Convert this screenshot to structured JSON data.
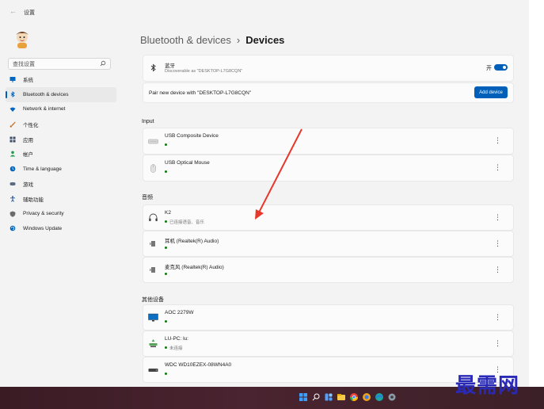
{
  "window": {
    "title": "设置"
  },
  "search": {
    "placeholder": "查找设置"
  },
  "sidebar": {
    "items": [
      {
        "label": "系统",
        "icon": "monitor-icon",
        "color": "#0067c0",
        "active": false
      },
      {
        "label": "Bluetooth & devices",
        "icon": "bluetooth-icon",
        "color": "#0067c0",
        "active": true
      },
      {
        "label": "Network & internet",
        "icon": "wifi-icon",
        "color": "#0067c0",
        "active": false
      },
      {
        "label": "个性化",
        "icon": "brush-icon",
        "color": "#c26b1b",
        "active": false
      },
      {
        "label": "应用",
        "icon": "apps-icon",
        "color": "#3c4b66",
        "active": false
      },
      {
        "label": "帐户",
        "icon": "person-icon",
        "color": "#1d9a4b",
        "active": false
      },
      {
        "label": "Time & language",
        "icon": "globe-clock-icon",
        "color": "#0067c0",
        "active": false
      },
      {
        "label": "游戏",
        "icon": "gamepad-icon",
        "color": "#5d6b82",
        "active": false
      },
      {
        "label": "辅助功能",
        "icon": "accessibility-icon",
        "color": "#1b4f9c",
        "active": false
      },
      {
        "label": "Privacy & security",
        "icon": "shield-icon",
        "color": "#6b6b6b",
        "active": false
      },
      {
        "label": "Windows Update",
        "icon": "update-icon",
        "color": "#0067c0",
        "active": false
      }
    ]
  },
  "breadcrumb": {
    "parent": "Bluetooth & devices",
    "separator": "›",
    "current": "Devices"
  },
  "bluetooth": {
    "title": "蓝牙",
    "subtitle": "Discoverable as \"DESKTOP-L7G8CQN\"",
    "toggle_label": "开",
    "toggle_on": true
  },
  "pair": {
    "text": "Pair new device with \"DESKTOP-L7G8CQN\"",
    "button": "Add device"
  },
  "sections": {
    "input": "Input",
    "audio": "音频",
    "other": "其他设备"
  },
  "input_devices": [
    {
      "name": "USB Composite Device",
      "icon": "keyboard-icon"
    },
    {
      "name": "USB Optical Mouse",
      "icon": "mouse-icon"
    }
  ],
  "audio_devices": [
    {
      "name": "K2",
      "status": "已连接语音、音乐",
      "icon": "headphones-icon"
    },
    {
      "name": "耳机 (Realtek(R) Audio)",
      "status": "",
      "icon": "speaker-icon"
    },
    {
      "name": "麦克风 (Realtek(R) Audio)",
      "status": "",
      "icon": "speaker-icon"
    }
  ],
  "other_devices": [
    {
      "name": "AOC 2279W",
      "status": "",
      "icon": "display-icon"
    },
    {
      "name": "LU-PC: lu:",
      "status": "未连接",
      "icon": "network-drive-icon"
    },
    {
      "name": "WDC WD10EZEX-08WN4A0",
      "status": "",
      "icon": "hard-drive-icon"
    }
  ],
  "more_glyph": "⋮",
  "taskbar": {
    "icons": [
      "windows-icon",
      "search-icon",
      "widgets-icon",
      "explorer-icon",
      "chrome-icon",
      "browser-icon",
      "edge-icon",
      "settings-icon"
    ]
  },
  "watermark": "最需网",
  "colors": {
    "accent": "#005fb8",
    "connected": "#0f7b0f",
    "annotation_arrow": "#e8382b"
  }
}
